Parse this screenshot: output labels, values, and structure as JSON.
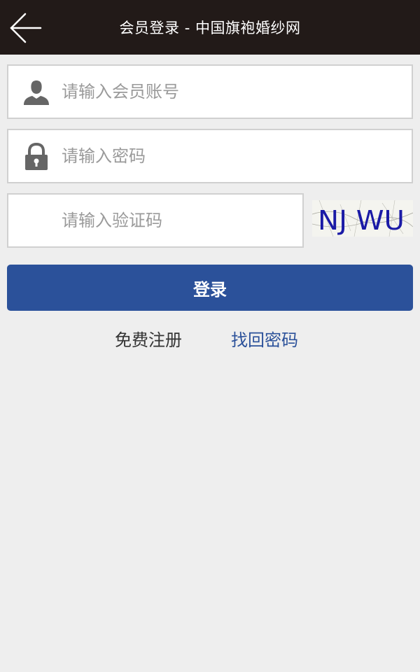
{
  "header": {
    "title": "会员登录 - 中国旗袍婚纱网",
    "back_icon": "arrow-left-icon"
  },
  "form": {
    "username": {
      "placeholder": "请输入会员账号",
      "value": "",
      "icon": "user-icon"
    },
    "password": {
      "placeholder": "请输入密码",
      "value": "",
      "icon": "lock-icon"
    },
    "captcha_input": {
      "placeholder": "请输入验证码",
      "value": ""
    },
    "captcha_image_text": "NJ WU",
    "login_label": "登录"
  },
  "links": {
    "register": "免费注册",
    "forgot_password": "找回密码"
  },
  "colors": {
    "header_bg": "#221a18",
    "page_bg": "#eeeeee",
    "primary": "#2b519a",
    "captcha_text": "#1a1aa6"
  }
}
